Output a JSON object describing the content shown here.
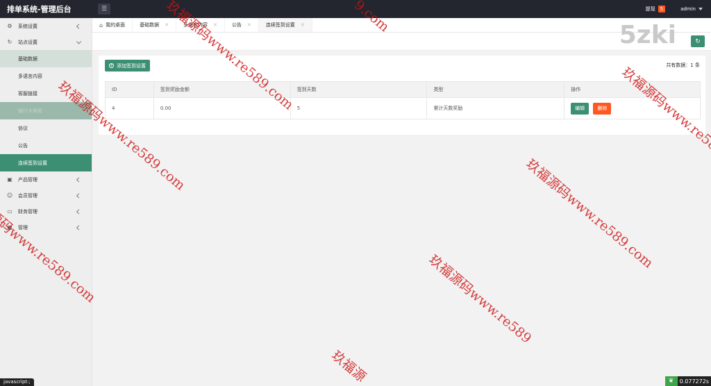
{
  "header": {
    "title": "排单系统-管理后台",
    "withdraw_label": "提现",
    "withdraw_count": "5",
    "user": "admin"
  },
  "sidebar": {
    "items": [
      {
        "label": "系统设置",
        "icon": "gear-icon"
      },
      {
        "label": "站点设置",
        "icon": "refresh-icon"
      },
      {
        "label": "产品管理",
        "icon": "cube-icon"
      },
      {
        "label": "会员管理",
        "icon": "user-icon"
      },
      {
        "label": "财务管理",
        "icon": "wallet-icon"
      },
      {
        "label": "管理",
        "icon": "box-icon"
      }
    ],
    "sub_items": [
      {
        "label": "基础数据"
      },
      {
        "label": "多语言内容"
      },
      {
        "label": "客服链接"
      },
      {
        "label": "银行卡类型"
      },
      {
        "label": "协议"
      },
      {
        "label": "公告"
      },
      {
        "label": "连续签到设置"
      }
    ]
  },
  "tabs": [
    {
      "label": "我的桌面"
    },
    {
      "label": "基础数据"
    },
    {
      "label": "多语言内容"
    },
    {
      "label": "公告"
    },
    {
      "label": "连续签到设置"
    }
  ],
  "content": {
    "add_label": "添加签到设置",
    "total_label": "共有数据：1 条",
    "columns": [
      "ID",
      "签到奖励金额",
      "签到天数",
      "类型",
      "操作"
    ],
    "rows": [
      {
        "id": "4",
        "amount": "0.00",
        "days": "5",
        "type": "累计天数奖励",
        "edit": "编辑",
        "delete": "删除"
      }
    ]
  },
  "watermark": {
    "text": "玖福源码www.re589.com",
    "fragment_top": "9.com",
    "partial_bottom": "玖福源",
    "partial_left": "源码www.re589.com",
    "partial_right": "玖福源码www.re589",
    "brand": "5zki"
  },
  "status": {
    "js": "javascript:;",
    "time": "0.077272s"
  }
}
